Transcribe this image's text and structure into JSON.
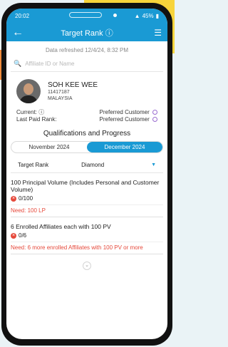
{
  "status": {
    "time": "20:02",
    "battery": "45%"
  },
  "appbar": {
    "title": "Target Rank"
  },
  "refreshed": "Data refreshed 12/4/24, 8:32 PM",
  "search": {
    "placeholder": "Affiliate ID or Name"
  },
  "profile": {
    "name": "SOH KEE WEE",
    "id": "11417187",
    "country": "MALAYSIA"
  },
  "ranks": {
    "current_label": "Current:",
    "current_value": "Preferred Customer",
    "last_paid_label": "Last Paid Rank:",
    "last_paid_value": "Preferred Customer"
  },
  "section_title": "Qualifications and Progress",
  "tabs": [
    {
      "label": "November 2024",
      "active": false
    },
    {
      "label": "December 2024",
      "active": true
    }
  ],
  "target": {
    "label": "Target Rank",
    "value": "Diamond"
  },
  "requirements": [
    {
      "title": "100 Principal Volume (Includes Personal and Customer Volume)",
      "progress": "0/100",
      "need": "Need: 100 LP"
    },
    {
      "title": "6 Enrolled Affiliates each with 100 PV",
      "progress": "0/6",
      "need": "Need: 6 more enrolled Affiliates with 100 PV or more"
    }
  ],
  "colors": {
    "primary": "#1a9ad4",
    "error": "#e64a3c",
    "accent_yellow": "#f7d43b",
    "accent_orange": "#f08a3b"
  }
}
